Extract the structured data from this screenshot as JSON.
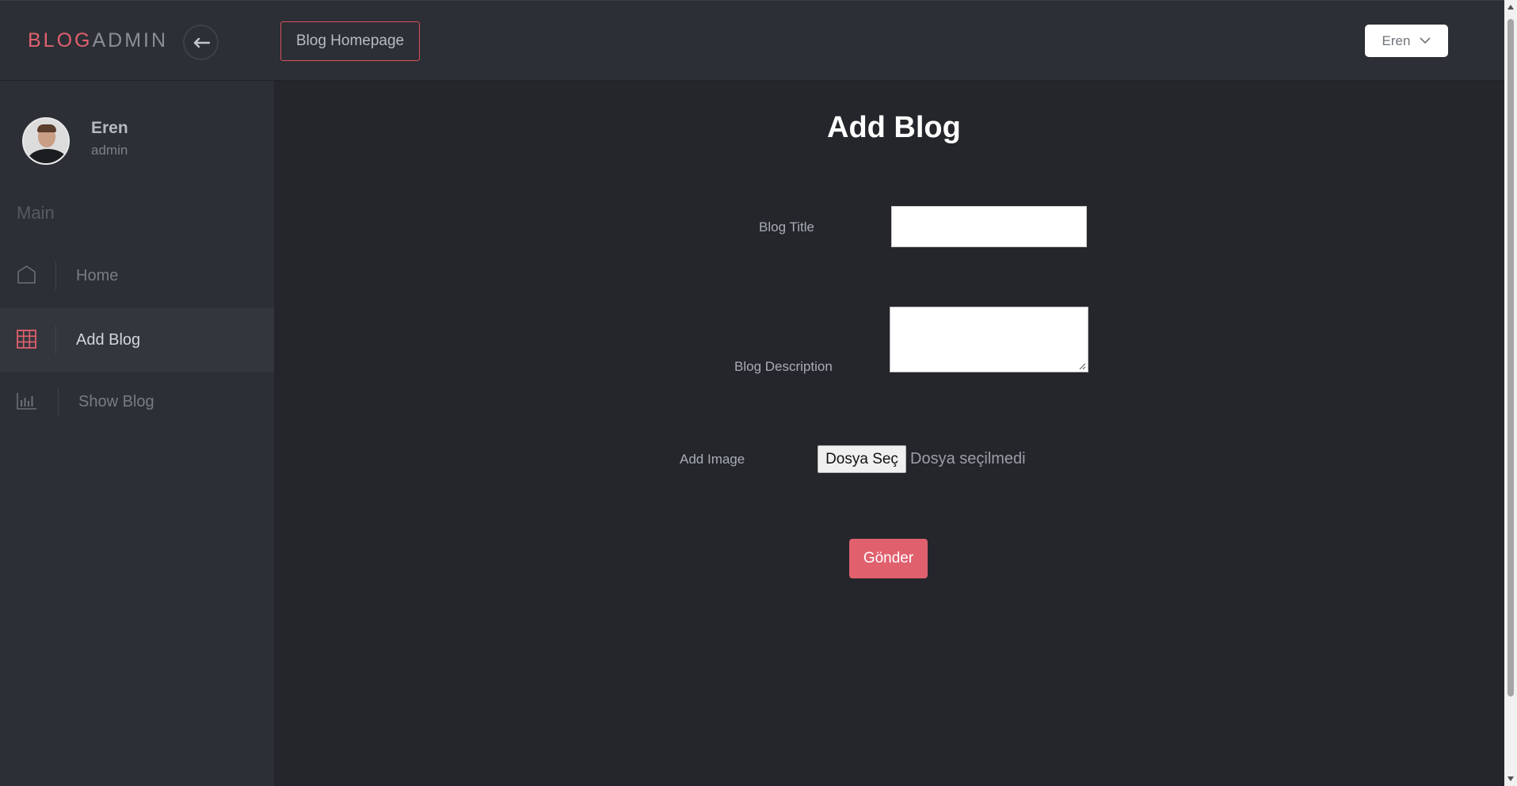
{
  "header": {
    "logo_part1": "BLOG",
    "logo_part2": "ADMIN",
    "back_icon": "arrow-left-icon",
    "homepage_link": "Blog Homepage",
    "user_dropdown": "Eren"
  },
  "sidebar": {
    "user": {
      "name": "Eren",
      "role": "admin"
    },
    "section_label": "Main",
    "items": [
      {
        "label": "Home",
        "icon": "home-icon",
        "active": false
      },
      {
        "label": "Add Blog",
        "icon": "grid-icon",
        "active": true
      },
      {
        "label": "Show Blog",
        "icon": "bar-chart-icon",
        "active": false
      }
    ]
  },
  "main": {
    "title": "Add Blog",
    "form": {
      "title_label": "Blog Title",
      "title_value": "",
      "description_label": "Blog Description",
      "description_value": "",
      "image_label": "Add Image",
      "file_button": "Dosya Seç",
      "file_status": "Dosya seçilmedi",
      "submit": "Gönder"
    }
  },
  "colors": {
    "accent": "#e0606e",
    "sidebar_bg": "#2c2f35",
    "main_bg": "#24262b"
  }
}
